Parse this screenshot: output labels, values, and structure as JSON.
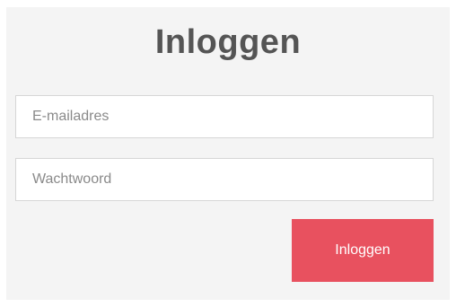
{
  "login": {
    "title": "Inloggen",
    "email_placeholder": "E-mailadres",
    "email_value": "",
    "password_placeholder": "Wachtwoord",
    "password_value": "",
    "submit_label": "Inloggen"
  },
  "colors": {
    "panel_background": "#f4f4f4",
    "title": "#555555",
    "button_background": "#e8515f",
    "button_text": "#ffffff",
    "field_border": "#d6d6d6"
  }
}
